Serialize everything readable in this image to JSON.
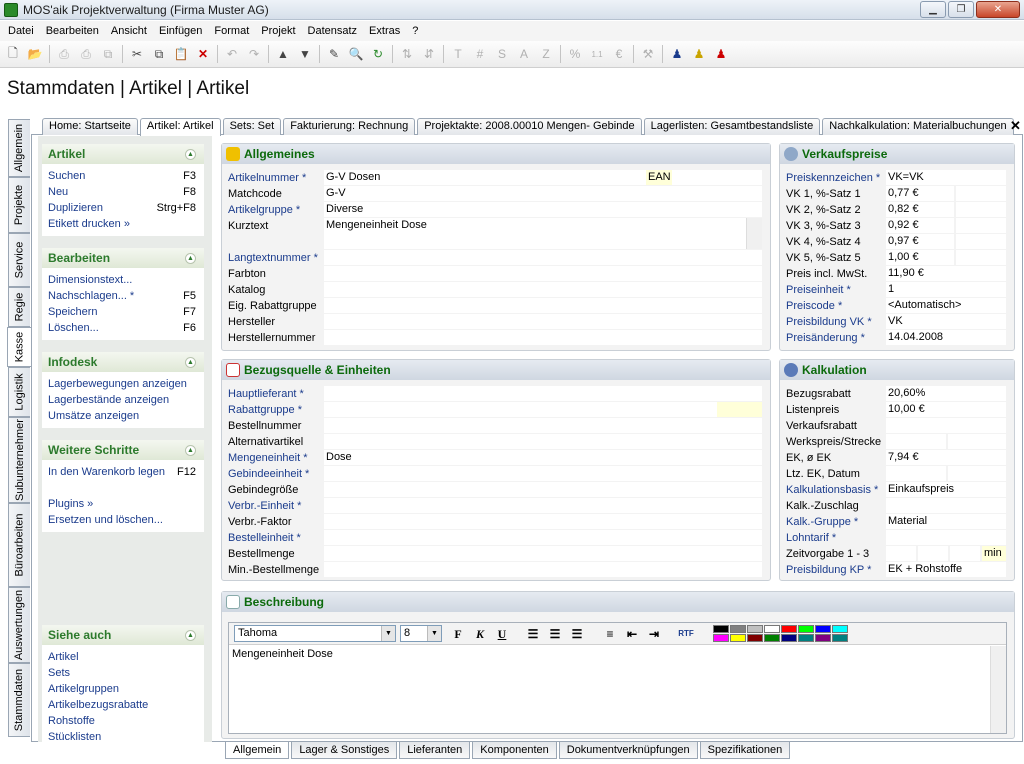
{
  "window": {
    "title": "MOS'aik Projektverwaltung (Firma Muster AG)"
  },
  "menu": [
    "Datei",
    "Bearbeiten",
    "Ansicht",
    "Einfügen",
    "Format",
    "Projekt",
    "Datensatz",
    "Extras",
    "?"
  ],
  "page_title": "Stammdaten | Artikel | Artikel",
  "vertical_tabs": [
    "Allgemein",
    "Projekte",
    "Service",
    "Regie",
    "Kasse",
    "Logistik",
    "Subunternehmer",
    "Büroarbeiten",
    "Auswertungen",
    "Stammdaten"
  ],
  "active_vertical_tab": "Kasse",
  "top_tabs": [
    "Home: Startseite",
    "Artikel: Artikel",
    "Sets: Set",
    "Fakturierung: Rechnung",
    "Projektakte: 2008.00010 Mengen- Gebinde",
    "Lagerlisten: Gesamtbestandsliste",
    "Nachkalkulation: Materialbuchungen"
  ],
  "active_top_tab": "Artikel: Artikel",
  "sidebar": {
    "artikel": {
      "title": "Artikel",
      "items": [
        {
          "label": "Suchen",
          "shortcut": "F3"
        },
        {
          "label": "Neu",
          "shortcut": "F8"
        },
        {
          "label": "Duplizieren",
          "shortcut": "Strg+F8"
        },
        {
          "label": "Etikett drucken »",
          "shortcut": ""
        }
      ]
    },
    "bearbeiten": {
      "title": "Bearbeiten",
      "items": [
        {
          "label": "Dimensionstext...",
          "shortcut": ""
        },
        {
          "label": "Nachschlagen... *",
          "shortcut": "F5"
        },
        {
          "label": "Speichern",
          "shortcut": "F7"
        },
        {
          "label": "Löschen...",
          "shortcut": "F6"
        }
      ]
    },
    "infodesk": {
      "title": "Infodesk",
      "items": [
        {
          "label": "Lagerbewegungen anzeigen",
          "shortcut": ""
        },
        {
          "label": "Lagerbestände anzeigen",
          "shortcut": ""
        },
        {
          "label": "Umsätze anzeigen",
          "shortcut": ""
        }
      ]
    },
    "weitere": {
      "title": "Weitere Schritte",
      "items": [
        {
          "label": "In den Warenkorb legen",
          "shortcut": "F12"
        },
        {
          "label": "",
          "shortcut": ""
        },
        {
          "label": "Plugins »",
          "shortcut": ""
        },
        {
          "label": "Ersetzen und löschen...",
          "shortcut": ""
        }
      ]
    },
    "siehe": {
      "title": "Siehe auch",
      "items": [
        {
          "label": "Artikel",
          "shortcut": ""
        },
        {
          "label": "Sets",
          "shortcut": ""
        },
        {
          "label": "Artikelgruppen",
          "shortcut": ""
        },
        {
          "label": "Artikelbezugsrabatte",
          "shortcut": ""
        },
        {
          "label": "Rohstoffe",
          "shortcut": ""
        },
        {
          "label": "Stücklisten",
          "shortcut": ""
        }
      ]
    }
  },
  "allgemeines": {
    "title": "Allgemeines",
    "ean_label": "EAN",
    "rows": [
      {
        "label": "Artikelnummer *",
        "value": "G-V Dosen",
        "link": true
      },
      {
        "label": "Matchcode",
        "value": "G-V",
        "link": false
      },
      {
        "label": "Artikelgruppe *",
        "value": "Diverse",
        "link": true
      },
      {
        "label": "Kurztext",
        "value": "Mengeneinheit Dose",
        "link": false
      },
      {
        "label": "Langtextnummer *",
        "value": "",
        "link": true
      },
      {
        "label": "Farbton",
        "value": "",
        "link": false
      },
      {
        "label": "Katalog",
        "value": "",
        "link": false
      },
      {
        "label": "Eig. Rabattgruppe",
        "value": "",
        "link": false
      },
      {
        "label": "Hersteller",
        "value": "",
        "link": false
      },
      {
        "label": "Herstellernummer",
        "value": "",
        "link": false
      }
    ]
  },
  "bezugsquelle": {
    "title": "Bezugsquelle & Einheiten",
    "rows": [
      {
        "label": "Hauptlieferant *",
        "value": "",
        "link": true
      },
      {
        "label": "Rabattgruppe *",
        "value": "",
        "link": true
      },
      {
        "label": "Bestellnummer",
        "value": "",
        "link": false
      },
      {
        "label": "Alternativartikel",
        "value": "",
        "link": false
      },
      {
        "label": "Mengeneinheit *",
        "value": "Dose",
        "link": true
      },
      {
        "label": "Gebindeeinheit *",
        "value": "",
        "link": true
      },
      {
        "label": "Gebindegröße",
        "value": "",
        "link": false
      },
      {
        "label": "Verbr.-Einheit *",
        "value": "",
        "link": true
      },
      {
        "label": "Verbr.-Faktor",
        "value": "",
        "link": false
      },
      {
        "label": "Bestelleinheit *",
        "value": "",
        "link": true
      },
      {
        "label": "Bestellmenge",
        "value": "",
        "link": false
      },
      {
        "label": "Min.-Bestellmenge",
        "value": "",
        "link": false
      }
    ]
  },
  "verkaufspreise": {
    "title": "Verkaufspreise",
    "rows": [
      {
        "label": "Preiskennzeichen *",
        "value": "VK=VK",
        "link": true
      },
      {
        "label": "VK 1, %-Satz 1",
        "value": "0,77 €",
        "link": false
      },
      {
        "label": "VK 2, %-Satz 2",
        "value": "0,82 €",
        "link": false
      },
      {
        "label": "VK 3, %-Satz 3",
        "value": "0,92 €",
        "link": false
      },
      {
        "label": "VK 4, %-Satz 4",
        "value": "0,97 €",
        "link": false
      },
      {
        "label": "VK 5, %-Satz 5",
        "value": "1,00 €",
        "link": false
      },
      {
        "label": "Preis incl. MwSt.",
        "value": "11,90 €",
        "link": false
      },
      {
        "label": "Preiseinheit *",
        "value": "1",
        "link": true
      },
      {
        "label": "Preiscode *",
        "value": "<Automatisch>",
        "link": true
      },
      {
        "label": "Preisbildung VK *",
        "value": "VK",
        "link": true
      },
      {
        "label": "Preisänderung *",
        "value": "14.04.2008",
        "link": true
      }
    ]
  },
  "kalkulation": {
    "title": "Kalkulation",
    "min_label": "min",
    "rows": [
      {
        "label": "Bezugsrabatt",
        "value": "20,60%",
        "link": false
      },
      {
        "label": "Listenpreis",
        "value": "10,00 €",
        "link": false
      },
      {
        "label": "Verkaufsrabatt",
        "value": "",
        "link": false
      },
      {
        "label": "Werkspreis/Strecke",
        "value": "",
        "link": false
      },
      {
        "label": "EK, ø EK",
        "value": "7,94 €",
        "link": false
      },
      {
        "label": "Ltz. EK, Datum",
        "value": "",
        "link": false
      },
      {
        "label": "Kalkulationsbasis *",
        "value": "Einkaufspreis",
        "link": true
      },
      {
        "label": "Kalk.-Zuschlag",
        "value": "",
        "link": false
      },
      {
        "label": "Kalk.-Gruppe *",
        "value": "Material",
        "link": true
      },
      {
        "label": "Lohntarif *",
        "value": "",
        "link": true
      },
      {
        "label": "Zeitvorgabe 1 - 3",
        "value": "",
        "link": false
      },
      {
        "label": "Preisbildung KP *",
        "value": "EK + Rohstoffe",
        "link": true
      }
    ]
  },
  "beschreibung": {
    "title": "Beschreibung",
    "font": "Tahoma",
    "size": "8",
    "text": "Mengeneinheit Dose",
    "palette": [
      "#000000",
      "#808080",
      "#c0c0c0",
      "#ffffff",
      "#ff0000",
      "#00ff00",
      "#0000ff",
      "#00ffff",
      "#ff00ff",
      "#ffff00",
      "#800000",
      "#008000",
      "#000080",
      "#008080",
      "#800080",
      "#008080"
    ]
  },
  "bottom_tabs": [
    "Allgemein",
    "Lager & Sonstiges",
    "Lieferanten",
    "Komponenten",
    "Dokumentverknüpfungen",
    "Spezifikationen"
  ],
  "active_bottom_tab": "Allgemein"
}
